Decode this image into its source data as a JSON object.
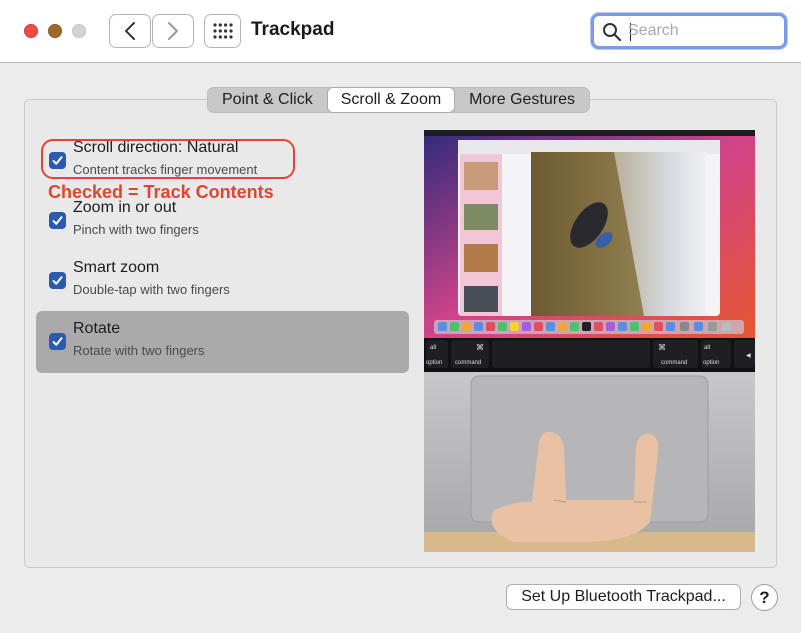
{
  "window": {
    "title": "Trackpad"
  },
  "toolbar": {
    "back_icon": "chevron-left-icon",
    "forward_icon": "chevron-right-icon",
    "grid_icon": "grid-icon"
  },
  "search": {
    "placeholder": "Search",
    "value": ""
  },
  "tabs": [
    {
      "label": "Point & Click",
      "active": false
    },
    {
      "label": "Scroll & Zoom",
      "active": true
    },
    {
      "label": "More Gestures",
      "active": false
    }
  ],
  "options": [
    {
      "label": "Scroll direction: Natural",
      "description": "Content tracks finger movement",
      "checked": true
    },
    {
      "label": "Zoom in or out",
      "description": "Pinch with two fingers",
      "checked": true
    },
    {
      "label": "Smart zoom",
      "description": "Double-tap with two fingers",
      "checked": true
    },
    {
      "label": "Rotate",
      "description": "Rotate with two fingers",
      "checked": true,
      "highlighted": true
    }
  ],
  "annotation": {
    "text": "Checked = Track Contents",
    "color": "#e2452e"
  },
  "preview": {
    "keys": [
      "alt",
      "option",
      "⌘",
      "command",
      "⌘",
      "command",
      "alt",
      "option",
      "◀"
    ]
  },
  "footer": {
    "setup_button": "Set Up Bluetooth Trackpad...",
    "help_button": "?"
  },
  "colors": {
    "checkbox": "#2a5bb0",
    "search_focus": "#7b9be6",
    "close": "#ee4b43",
    "minimize": "#9b6a2a"
  }
}
